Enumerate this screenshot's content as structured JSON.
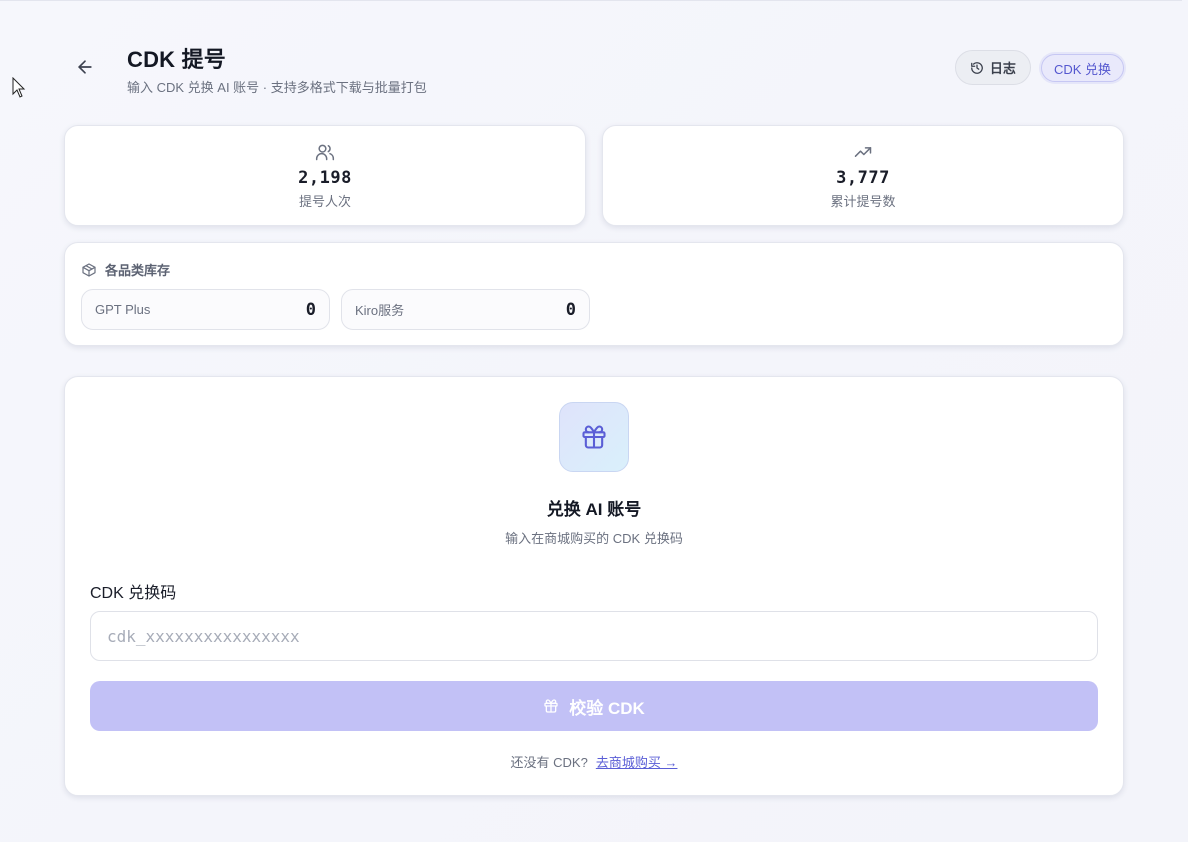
{
  "header": {
    "title": "CDK 提号",
    "subtitle": "输入 CDK 兑换 AI 账号 · 支持多格式下载与批量打包",
    "log_label": "日志",
    "cdk_label": "CDK 兑换"
  },
  "stats": [
    {
      "icon": "users-icon",
      "value": "2,198",
      "label": "提号人次"
    },
    {
      "icon": "trending-up-icon",
      "value": "3,777",
      "label": "累计提号数"
    }
  ],
  "inventory": {
    "title": "各品类库存",
    "items": [
      {
        "name": "GPT Plus",
        "count": "0"
      },
      {
        "name": "Kiro服务",
        "count": "0"
      }
    ]
  },
  "redeem": {
    "title": "兑换 AI 账号",
    "subtitle": "输入在商城购买的 CDK 兑换码",
    "field_label": "CDK 兑换码",
    "input_value": "",
    "input_placeholder": "cdk_xxxxxxxxxxxxxxxx",
    "button_label": "校验 CDK",
    "footer_text": "还没有 CDK?",
    "footer_link": "去商城购买 →"
  },
  "colors": {
    "accent": "#5a5ed6",
    "button_disabled": "#c2c1f6",
    "card_border": "#e4e6ee"
  }
}
